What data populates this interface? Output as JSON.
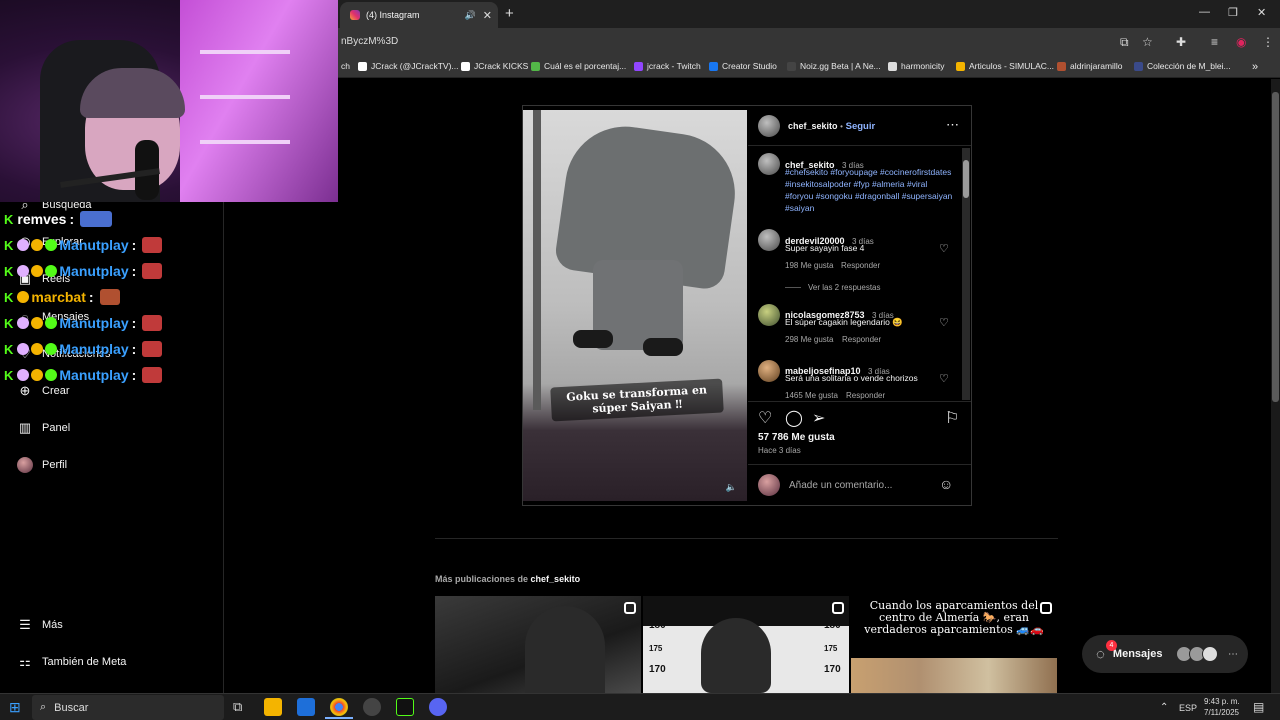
{
  "browser": {
    "tab_title": "(4) Instagram",
    "url_fragment": "nByczM%3D",
    "new_tab": "+",
    "bookmarks": [
      {
        "label": "ch",
        "color": "#555555"
      },
      {
        "label": "JCrack (@JCrackTV)...",
        "color": "#ffffff"
      },
      {
        "label": "JCrack KICKS",
        "color": "#ffffff"
      },
      {
        "label": "Cuál es el porcentaj...",
        "color": "#53b848"
      },
      {
        "label": "jcrack - Twitch",
        "color": "#9146ff"
      },
      {
        "label": "Creator Studio",
        "color": "#1877f2"
      },
      {
        "label": "Noiz.gg Beta | A Ne...",
        "color": "#444444"
      },
      {
        "label": "harmonicity",
        "color": "#dddddd"
      },
      {
        "label": "Articulos - SIMULAC...",
        "color": "#f4b400"
      },
      {
        "label": "aldrinjaramillo",
        "color": "#b05030"
      },
      {
        "label": "Colección de M_blei...",
        "color": "#3a4a8a"
      }
    ]
  },
  "sidebar": {
    "items": [
      {
        "label": "Búsqueda",
        "icon": "search-icon"
      },
      {
        "label": "Explorar",
        "icon": "compass-icon"
      },
      {
        "label": "Reels",
        "icon": "reels-icon"
      },
      {
        "label": "Mensajes",
        "icon": "messenger-icon",
        "badge": "4"
      },
      {
        "label": "Notificaciones",
        "icon": "heart-icon"
      },
      {
        "label": "Crear",
        "icon": "plus-icon"
      },
      {
        "label": "Panel",
        "icon": "chart-icon"
      },
      {
        "label": "Perfil",
        "icon": "avatar"
      }
    ],
    "more": "Más",
    "meta": "También de Meta"
  },
  "chat": [
    {
      "name": "remves",
      "colon": ":",
      "color": "#ffffff"
    },
    {
      "name": "Manutplay",
      "colon": ":",
      "color": "#3aa0ff"
    },
    {
      "name": "Manutplay",
      "colon": ":",
      "color": "#3aa0ff"
    },
    {
      "name": "marcbat",
      "colon": ":",
      "color": "#f4b400"
    },
    {
      "name": "Manutplay",
      "colon": ":",
      "color": "#3aa0ff"
    },
    {
      "name": "Manutplay",
      "colon": ":",
      "color": "#3aa0ff"
    },
    {
      "name": "Manutplay",
      "colon": ":",
      "color": "#3aa0ff"
    }
  ],
  "post": {
    "video_caption": "Goku se transforma en súper Saiyan ‼",
    "header_user": "chef_sekito",
    "follow_sep": "•",
    "follow": "Seguir",
    "caption_user": "chef_sekito",
    "caption_time": "3 días",
    "caption_tags": "#chefsekito #foryoupage #cocinerofirstdates #insekitosalpoder #fyp #almeria #viral #foryou #songoku #dragonball #supersaiyan #saiyan",
    "comments": [
      {
        "user": "derdevil20000",
        "time": "3 días",
        "text": "Super sayayin fase 4",
        "likes": "198 Me gusta",
        "reply": "Responder",
        "replies": "Ver las 2 respuestas"
      },
      {
        "user": "nicolasgomez8753",
        "time": "3 días",
        "text": "El súper cagakin legendario 😆",
        "likes": "298 Me gusta",
        "reply": "Responder"
      },
      {
        "user": "mabeljosefinap10",
        "time": "3 días",
        "text": "Será una solitaria o vende chorizos",
        "likes": "1465 Me gusta",
        "reply": "Responder"
      }
    ],
    "likes": "57 786 Me gusta",
    "ago": "Hace 3 días",
    "comment_placeholder": "Añade un comentario..."
  },
  "more": {
    "prefix": "Más publicaciones de",
    "user": "chef_sekito",
    "thumb3_caption": "Cuando los aparcamientos del centro de Almería 🐎, eran verdaderos aparcamientos 🚙🚗",
    "thumb2_numbers": [
      "185",
      "180",
      "175",
      "170",
      "185",
      "180",
      "175",
      "170"
    ]
  },
  "messages_pill": {
    "label": "Mensajes",
    "badge": "4"
  },
  "taskbar": {
    "search": "Buscar",
    "lang": "ESP",
    "time": "9:43 p. m.",
    "date": "7/11/2025"
  },
  "colors": {
    "accent_link": "#8fb4ff",
    "kick_green": "#53fc18",
    "notif_red": "#ff3040"
  }
}
